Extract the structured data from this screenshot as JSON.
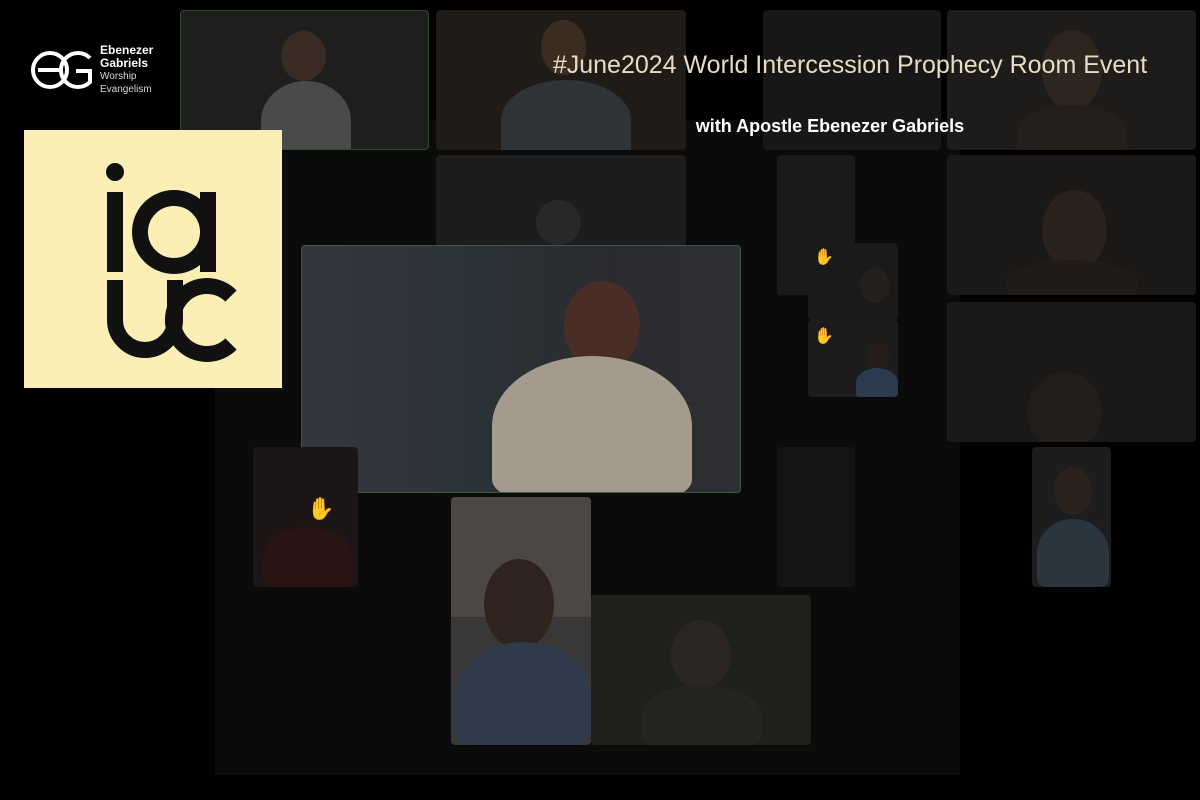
{
  "brand": {
    "name_line1": "Ebenezer",
    "name_line2": "Gabriels",
    "tag_line1": "Worship",
    "tag_line2": "Evangelism",
    "logo_mark": "EG"
  },
  "iauc_logo": {
    "text": "iauc",
    "background": "#fcefb6",
    "foreground": "#111111"
  },
  "event": {
    "title": "#June2024 World Intercession Prophecy Room Event",
    "subtitle": "with Apostle Ebenezer Gabriels"
  },
  "participants": {
    "count_visible": 19,
    "raised_hand_icon": "raised-hand-icon",
    "featured_speaker_tile": "center-speaker"
  },
  "colors": {
    "background": "#000000",
    "title_text": "#e8dcc0",
    "subtitle_text": "#ffffff",
    "active_speaker_border": "#2f4a2f"
  }
}
